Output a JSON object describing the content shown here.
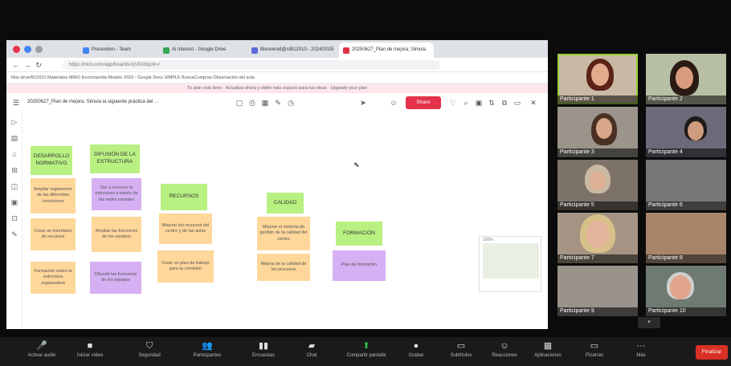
{
  "browser": {
    "tabs": [
      {
        "label": "Presentem - Team",
        "color": "#4285f4"
      },
      {
        "label": "Ai Interest - Google Drive",
        "color": "#34a853"
      },
      {
        "label": "Bienvenid@s/B12010 - 2024/2025",
        "color": "#5f6bd9"
      },
      {
        "label": "20250627_Plan de mejora; Simula",
        "color": "#e3324a"
      }
    ],
    "url": "https://miro.com/app/board/uXjVI0GtqUk=/",
    "bookmarks": "Nos sirve/B12010  Materiales MIRO  Enciclopedia Modelo  2023 - Google Docs  SIMPLE  BuscaCompras  Observación del aula",
    "banner": "Tu plan está lleno · Actualiza ahora y obtén más espacio para tus ideas · Upgrade your plan"
  },
  "miro": {
    "board_title": "20250627_Plan de mejora: Simula la siguiente práctica del ...",
    "share_label": "Share",
    "minimap_label": "100%",
    "notes": [
      {
        "text": "DESARROLLO NORMATIVO",
        "color": "green"
      },
      {
        "text": "DIFUSIÓN DE LA ESTRUCTURA",
        "color": "green"
      },
      {
        "text": "RECURSOS",
        "color": "green"
      },
      {
        "text": "CALIDAD",
        "color": "green"
      },
      {
        "text": "FORMACIÓN",
        "color": "green"
      },
      {
        "text": "Ampliar reglamento de las diferentes comisiones",
        "color": "orange"
      },
      {
        "text": "Dar a conocer la estructura a través de las redes sociales",
        "color": "purple"
      },
      {
        "text": "Mejorar los recursos del centro y de las aulas",
        "color": "orange"
      },
      {
        "text": "Mejorar el sistema de gestión de la calidad del centro",
        "color": "orange"
      },
      {
        "text": "Crear un plan de trabajo para la comisión",
        "color": "orange"
      },
      {
        "text": "Difundir las funciones de los equipos",
        "color": "purple"
      },
      {
        "text": "Crear un inventario de recursos",
        "color": "orange"
      },
      {
        "text": "Mejora de la calidad de los procesos",
        "color": "orange"
      },
      {
        "text": "Plan de formación",
        "color": "purple"
      },
      {
        "text": "Ampliar las funciones de los equipos",
        "color": "orange"
      },
      {
        "text": "Formación sobre la estructura organizativa",
        "color": "purple"
      }
    ]
  },
  "participants": [
    {
      "name": "Participante 1"
    },
    {
      "name": "Participante 2"
    },
    {
      "name": "Participante 3"
    },
    {
      "name": "Participante 4"
    },
    {
      "name": "Participante 5"
    },
    {
      "name": "Participante 6"
    },
    {
      "name": "Participante 7"
    },
    {
      "name": "Participante 8"
    },
    {
      "name": "Participante 9"
    },
    {
      "name": "Participante 10"
    }
  ],
  "zoom_controls": [
    {
      "label": "Activar audio",
      "icon": "mic-icon"
    },
    {
      "label": "Iniciar vídeo",
      "icon": "video-icon"
    },
    {
      "label": "Seguridad",
      "icon": "shield-icon"
    },
    {
      "label": "Participantes",
      "icon": "people-icon"
    },
    {
      "label": "Encuestas",
      "icon": "poll-icon"
    },
    {
      "label": "Chat",
      "icon": "chat-icon"
    },
    {
      "label": "Compartir pantalla",
      "icon": "share-screen-icon"
    },
    {
      "label": "Grabar",
      "icon": "record-icon"
    },
    {
      "label": "Subtítulos",
      "icon": "captions-icon"
    },
    {
      "label": "Reacciones",
      "icon": "reactions-icon"
    },
    {
      "label": "Aplicaciones",
      "icon": "apps-icon"
    },
    {
      "label": "Pizarras",
      "icon": "whiteboard-icon"
    },
    {
      "label": "Más",
      "icon": "more-icon"
    }
  ],
  "end_label": "Finalizar"
}
